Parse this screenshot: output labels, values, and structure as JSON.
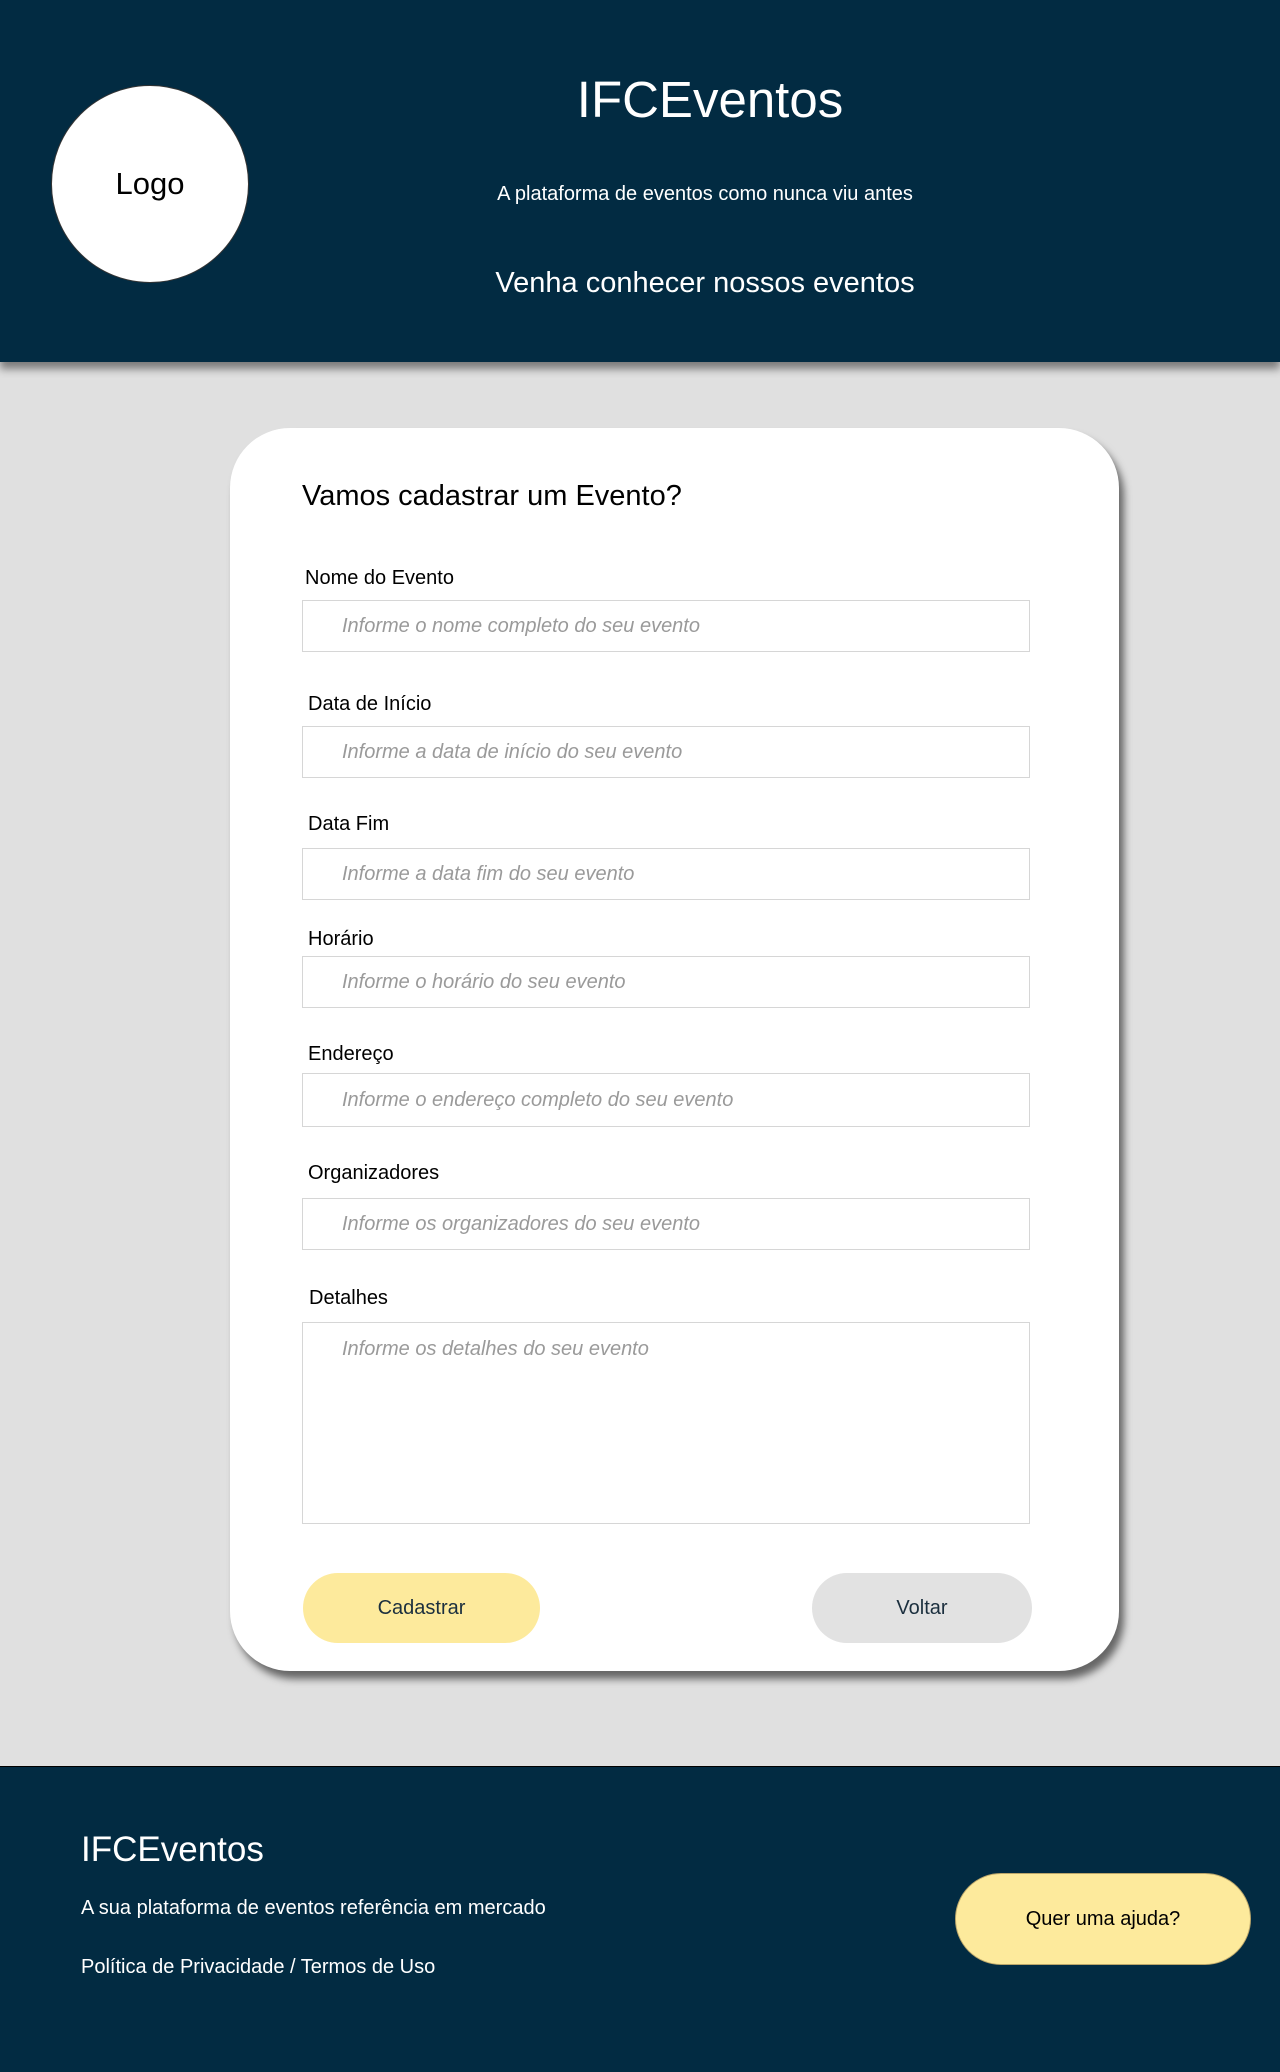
{
  "header": {
    "logo_text": "Logo",
    "title": "IFCEventos",
    "tagline": "A plataforma de eventos como nunca viu antes",
    "intro": "Venha conhecer nossos eventos"
  },
  "form": {
    "title": "Vamos cadastrar um Evento?",
    "fields": [
      {
        "label": "Nome do Evento",
        "placeholder": "Informe o nome completo do seu evento"
      },
      {
        "label": "Data de Início",
        "placeholder": "Informe a data de início do seu evento"
      },
      {
        "label": "Data Fim",
        "placeholder": "Informe a data fim do seu evento"
      },
      {
        "label": "Horário",
        "placeholder": "Informe o horário do seu evento"
      },
      {
        "label": "Endereço",
        "placeholder": "Informe o endereço completo do seu evento"
      },
      {
        "label": "Organizadores",
        "placeholder": "Informe os organizadores do seu evento"
      },
      {
        "label": "Detalhes",
        "placeholder": "Informe os detalhes do seu evento"
      }
    ],
    "submit_label": "Cadastrar",
    "back_label": "Voltar"
  },
  "footer": {
    "title": "IFCEventos",
    "tagline": "A sua plataforma de eventos referência em mercado",
    "links": "Política de Privacidade / Termos de Uso",
    "help_label": "Quer uma ajuda?"
  },
  "colors": {
    "primary": "#022b42",
    "accent": "#fdea9c",
    "background": "#e0e0e0",
    "secondary_button": "#e2e2e2"
  }
}
